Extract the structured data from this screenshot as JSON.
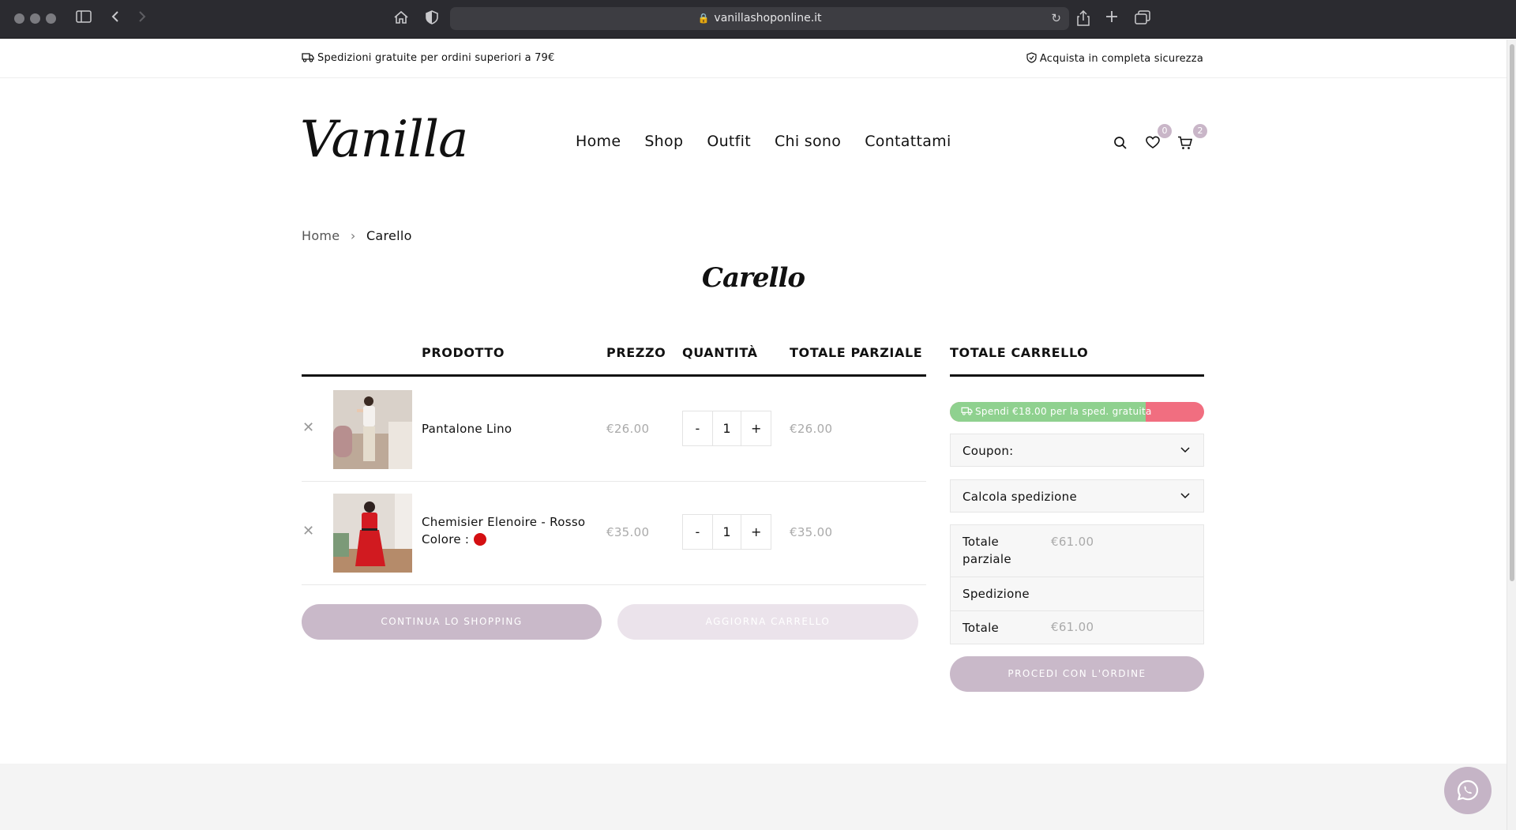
{
  "browser": {
    "url": "vanillashoponline.it"
  },
  "topbar": {
    "shipping_notice": "Spedizioni gratuite per ordini superiori a 79€",
    "security_notice": "Acquista in completa sicurezza"
  },
  "header": {
    "logo_text": "Vanilla",
    "nav": [
      "Home",
      "Shop",
      "Outfit",
      "Chi sono",
      "Contattami"
    ],
    "wishlist_count": "0",
    "cart_count": "2"
  },
  "breadcrumb": {
    "home": "Home",
    "current": "Carello"
  },
  "page_title": "Carello",
  "cart_table": {
    "headers": {
      "product": "PRODOTTO",
      "price": "PREZZO",
      "quantity": "QUANTITÀ",
      "subtotal": "TOTALE PARZIALE"
    },
    "items": [
      {
        "name": "Pantalone Lino",
        "price": "€26.00",
        "quantity": "1",
        "subtotal": "€26.00",
        "color_label": ""
      },
      {
        "name": "Chemisier Elenoire - Rosso",
        "price": "€35.00",
        "quantity": "1",
        "subtotal": "€35.00",
        "color_label": "Colore :",
        "color_value": "#d40f12"
      }
    ],
    "decrement_label": "-",
    "increment_label": "+",
    "continue_button": "CONTINUA LO SHOPPING",
    "update_button": "AGGIORNA CARRELLO"
  },
  "cart_totals": {
    "heading": "TOTALE CARRELLO",
    "free_shipping_text": "Spendi €18.00 per la sped. gratuita",
    "free_shipping_progress": 0.77,
    "coupon_label": "Coupon:",
    "shipping_calc_label": "Calcola spedizione",
    "subtotal_label": "Totale parziale",
    "subtotal_value": "€61.00",
    "shipping_label": "Spedizione",
    "total_label": "Totale",
    "total_value": "€61.00",
    "checkout_button": "PROCEDI CON L'ORDINE"
  },
  "colors": {
    "accent_button": "#c9b9c9",
    "progress_green": "#8fd18f",
    "progress_red": "#f16e80"
  }
}
